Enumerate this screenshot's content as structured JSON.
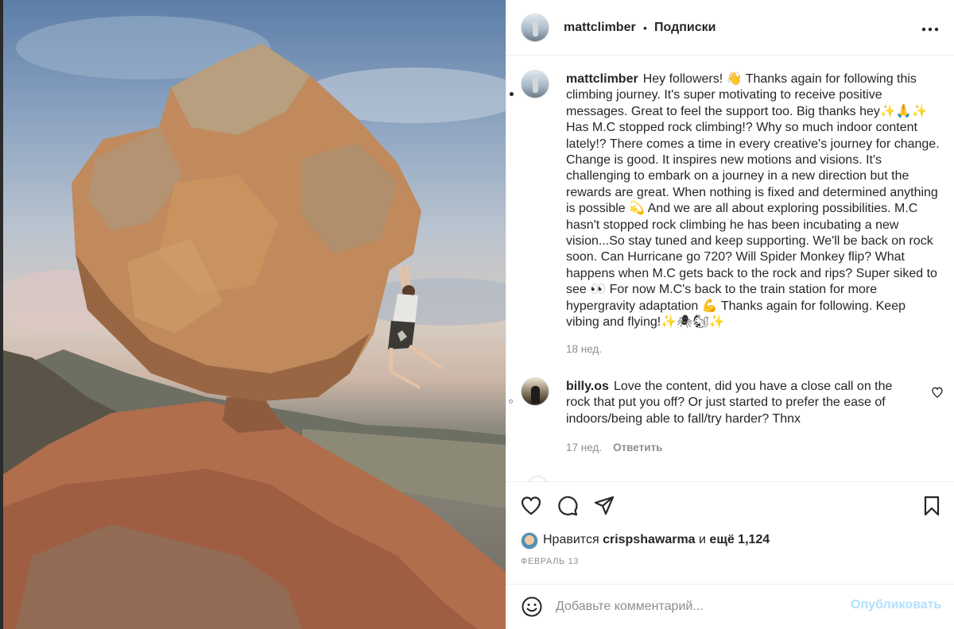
{
  "photo": {
    "alt_icon": "climber-boulder-photo"
  },
  "header": {
    "username": "mattclimber",
    "separator": "•",
    "follow_status": "Подписки",
    "more_icon": "more-horizontal-icon"
  },
  "caption": {
    "username": "mattclimber",
    "text": "Hey followers! 👋 Thanks again for following this climbing journey. It's super motivating to receive positive messages. Great to feel the support too. Big thanks hey✨🙏✨ Has M.C stopped rock climbing!? Why so much indoor content lately!? There comes a time in every creative's journey for change. Change is good. It inspires new motions and visions. It's challenging to embark on a journey in a new direction but the rewards are great. When nothing is fixed and determined anything is possible 💫 And we are all about exploring possibilities. M.C hasn't stopped rock climbing he has been incubating a new vision...So stay tuned and keep supporting. We'll be back on rock soon. Can Hurricane go 720? Will Spider Monkey flip? What happens when M.C gets back to the rock and rips? Super siked to see 👀 For now M.C's back to the train station for more hypergravity adaptation 💪 Thanks again for following. Keep vibing and flying!✨🕷🐿✨",
    "time": "18 нед."
  },
  "comment": {
    "username": "billy.os",
    "text": "Love the content, did you have a close call on the rock that put you off? Or just started to prefer the ease of indoors/being able to fall/try harder? Thnx",
    "time": "17 нед.",
    "reply_label": "Ответить"
  },
  "actions": {
    "like_icon": "heart-icon",
    "comment_icon": "comment-bubble-icon",
    "share_icon": "paper-plane-icon",
    "save_icon": "bookmark-icon"
  },
  "likes": {
    "prefix": "Нравится",
    "user": "crispshawarma",
    "conjunction": "и",
    "more": "ещё 1,124"
  },
  "date": "ФЕВРАЛЬ 13",
  "comment_box": {
    "placeholder": "Добавьте комментарий...",
    "publish_label": "Опубликовать",
    "emoji_icon": "smiley-icon"
  },
  "colors": {
    "text": "#262626",
    "secondary": "#8e8e8e",
    "publish_disabled": "#b2dffc",
    "border": "#efefef"
  }
}
